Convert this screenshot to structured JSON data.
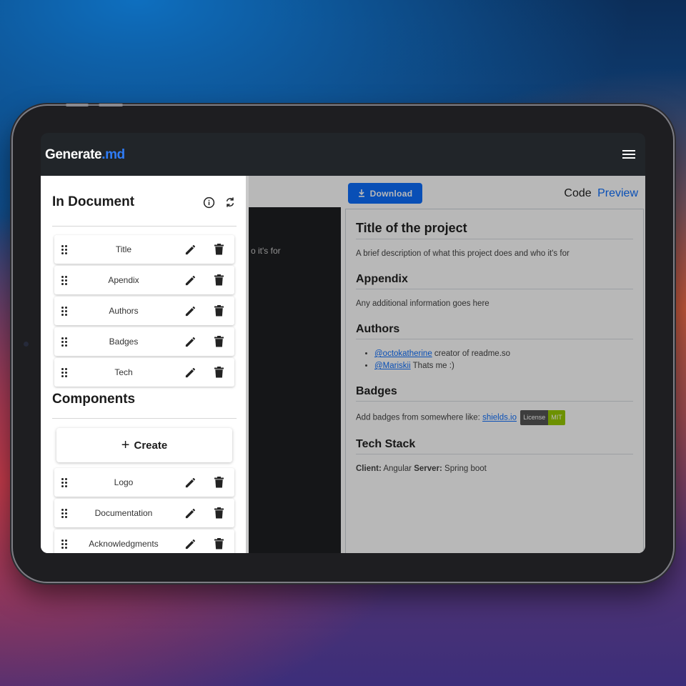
{
  "app": {
    "logo_main": "Generate",
    "logo_accent": ".md"
  },
  "toolbar": {
    "download_label": "Download",
    "code_label": "Code",
    "preview_label": "Preview"
  },
  "editor": {
    "visible_text": "o it's for"
  },
  "sidebar": {
    "in_document_title": "In Document",
    "components_title": "Components",
    "create_label": "Create",
    "in_document_items": [
      "Title",
      "Apendix",
      "Authors",
      "Badges",
      "Tech"
    ],
    "component_items": [
      "Logo",
      "Documentation",
      "Acknowledgments"
    ]
  },
  "preview": {
    "title": "Title of the project",
    "description": "A brief description of what this project does and who it's for",
    "appendix_heading": "Appendix",
    "appendix_text": "Any additional information goes here",
    "authors_heading": "Authors",
    "authors": [
      {
        "handle": "@octokatherine",
        "text": " creator of readme.so"
      },
      {
        "handle": "@Mariskii",
        "text": " Thats me :)"
      }
    ],
    "badges_heading": "Badges",
    "badges_text": "Add badges from somewhere like: ",
    "badges_link": "shields.io",
    "badge_left": "License",
    "badge_right": "MIT",
    "tech_heading": "Tech Stack",
    "client_label": "Client:",
    "client_value": " Angular ",
    "server_label": "Server:",
    "server_value": " Spring boot"
  }
}
